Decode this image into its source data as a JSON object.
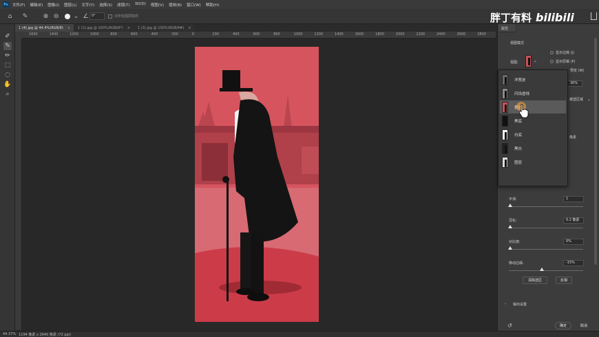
{
  "menubar": {
    "items": [
      "文件(F)",
      "编辑(E)",
      "图像(I)",
      "图层(L)",
      "文字(Y)",
      "选择(S)",
      "滤镜(T)",
      "3D(D)",
      "视图(V)",
      "增效(B)",
      "窗口(W)",
      "帮助(H)"
    ]
  },
  "options": {
    "angle_value": "0°",
    "sample_all_label": "对所有图层取样"
  },
  "tabs": [
    {
      "label": "1 (4).jpg @ 44.4%(RGB/8)",
      "active": true
    },
    {
      "label": "1 (1).jpg @ 100%(RGB/8*)",
      "active": false
    },
    {
      "label": "1 (3).jpg @ 100%(RGB/8#)",
      "active": false
    }
  ],
  "ruler_labels": [
    "1600",
    "1400",
    "1200",
    "1000",
    "800",
    "600",
    "400",
    "200",
    "0",
    "200",
    "400",
    "600",
    "800",
    "1000",
    "1200",
    "1400",
    "1600",
    "1800",
    "2000",
    "2200",
    "2400",
    "2600",
    "2800"
  ],
  "status": {
    "zoom": "44.37%",
    "doc_info": "1194 像素 x 2640 像素 (72 ppi)"
  },
  "watermark": {
    "text": "胖丁有料",
    "logo": "bilibili"
  },
  "panel": {
    "tab_label": "属性",
    "view_mode_title": "视图模式",
    "view_label": "视图:",
    "show_edge": "显示边缘 (J)",
    "show_original": "显示原稿 (P)",
    "preview_label": "预览 (W)",
    "opacity_value": "30%",
    "region_label": "被选区域",
    "pixel_label": "像素",
    "smooth_label": "平滑:",
    "smooth_value": "1",
    "feather_label": "羽化:",
    "feather_value": "0.2 像素",
    "contrast_label": "对比度:",
    "contrast_value": "0%",
    "shift_label": "移动边缘:",
    "shift_value": "-15%",
    "clear_btn": "清除选区",
    "invert_btn": "反相",
    "output_label": "输出设置",
    "ok_btn": "确定",
    "cancel_btn": "取消"
  },
  "dropdown": {
    "items": [
      {
        "label": "洋葱皮",
        "bg": "#6a6a6a"
      },
      {
        "label": "闪烁虚线",
        "bg": "#8a8a8a"
      },
      {
        "label": "叠加",
        "bg": "#c8505a"
      },
      {
        "label": "黑底",
        "bg": "#111111"
      },
      {
        "label": "白底",
        "bg": "#f4f4f4"
      },
      {
        "label": "黑白",
        "bg": "#222222"
      },
      {
        "label": "图层",
        "bg": "#dcdcdc"
      }
    ],
    "selected_index": 2
  },
  "colors": {
    "overlay": "#d6545e",
    "selected_item": "#5a5a5a"
  }
}
